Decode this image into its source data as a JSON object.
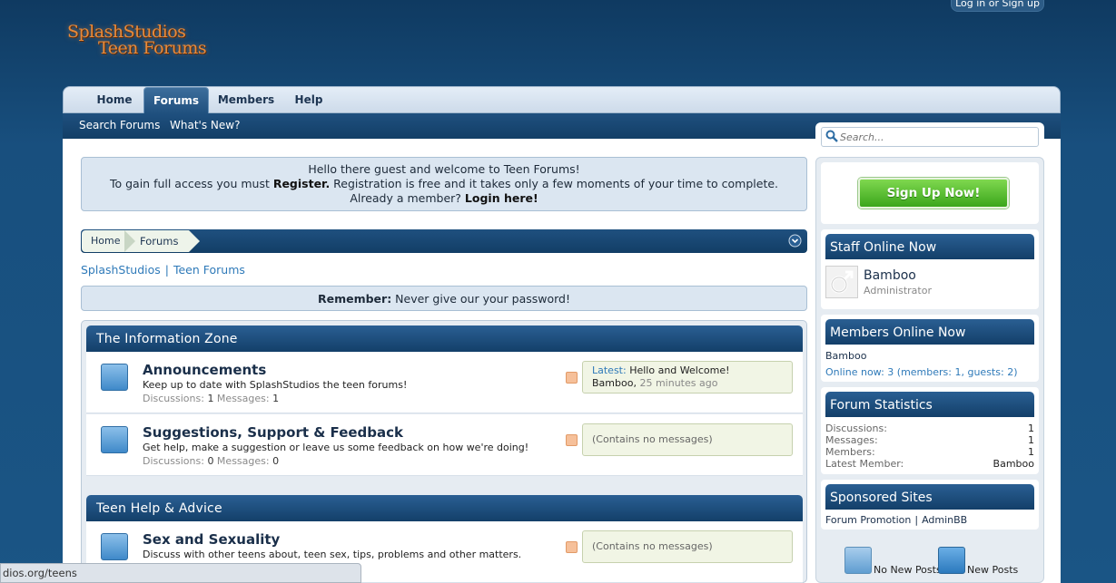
{
  "logo": {
    "line1": "SplashStudios",
    "line2": "Teen Forums"
  },
  "header": {
    "login_label": "Log in or Sign up"
  },
  "nav": {
    "tabs": [
      {
        "label": "Home"
      },
      {
        "label": "Forums"
      },
      {
        "label": "Members"
      },
      {
        "label": "Help"
      }
    ],
    "sub": [
      {
        "label": "Search Forums"
      },
      {
        "label": "What's New?"
      }
    ]
  },
  "search": {
    "placeholder": "Search..."
  },
  "welcome": {
    "line1": "Hello there guest and welcome to Teen Forums!",
    "line2_prefix": "To gain full access you must ",
    "line2_link": "Register.",
    "line2_suffix": " Registration is free and it takes only a few moments of your time to complete.",
    "line3_prefix": "Already a member? ",
    "line3_link": "Login here!"
  },
  "breadcrumb": {
    "home": "Home",
    "forums": "Forums"
  },
  "site_links": {
    "a": "SplashStudios",
    "sep": "|",
    "b": "Teen Forums"
  },
  "notice": {
    "label": "Remember:",
    "text": " Never give our your password!"
  },
  "categories": [
    {
      "title": "The Information Zone",
      "forums": [
        {
          "title": "Announcements",
          "desc": "Keep up to date with SplashStudios the teen forums!",
          "disc_label": "Discussions: ",
          "disc": "1",
          "msg_label": " Messages: ",
          "msg": "1",
          "latest_label": "Latest: ",
          "latest_title": "Hello and Welcome!",
          "latest_user": "Bamboo",
          "latest_sep": ", ",
          "latest_time": "25 minutes ago"
        },
        {
          "title": "Suggestions, Support & Feedback",
          "desc": "Get help, make a suggestion or leave us some feedback on how we're doing!",
          "disc_label": "Discussions: ",
          "disc": "0",
          "msg_label": " Messages: ",
          "msg": "0",
          "empty": "(Contains no messages)"
        }
      ]
    },
    {
      "title": "Teen Help & Advice",
      "forums": [
        {
          "title": "Sex and Sexuality",
          "desc": "Discuss with other teens about, teen sex, tips, problems and other matters.",
          "empty": "(Contains no messages)"
        }
      ]
    }
  ],
  "sidebar": {
    "signup_label": "Sign Up Now!",
    "staff": {
      "title": "Staff Online Now",
      "name": "Bamboo",
      "role": "Administrator"
    },
    "members": {
      "title": "Members Online Now",
      "name": "Bamboo",
      "online_label": "Online now: ",
      "online_count": "3",
      "online_detail_open": " (members: ",
      "online_members": "1",
      "online_detail_mid": ", guests: ",
      "online_guests": "2",
      "online_detail_close": ")"
    },
    "stats": {
      "title": "Forum Statistics",
      "rows": [
        {
          "label": "Discussions:",
          "value": "1"
        },
        {
          "label": "Messages:",
          "value": "1"
        },
        {
          "label": "Members:",
          "value": "1"
        },
        {
          "label": "Latest Member:",
          "value": "Bamboo"
        }
      ]
    },
    "sponsored": {
      "title": "Sponsored Sites",
      "a": "Forum Promotion",
      "sep": "|",
      "b": "AdminBB"
    },
    "legend": {
      "no_new": "No New Posts",
      "new": "New Posts"
    }
  },
  "status_bar": {
    "url": "dios.org/teens"
  },
  "colors": {
    "nav_dark": "#123e66",
    "accent_link": "#2f7ab9",
    "signup_green": "#3ba61c",
    "page_bg": "#184f7e"
  }
}
